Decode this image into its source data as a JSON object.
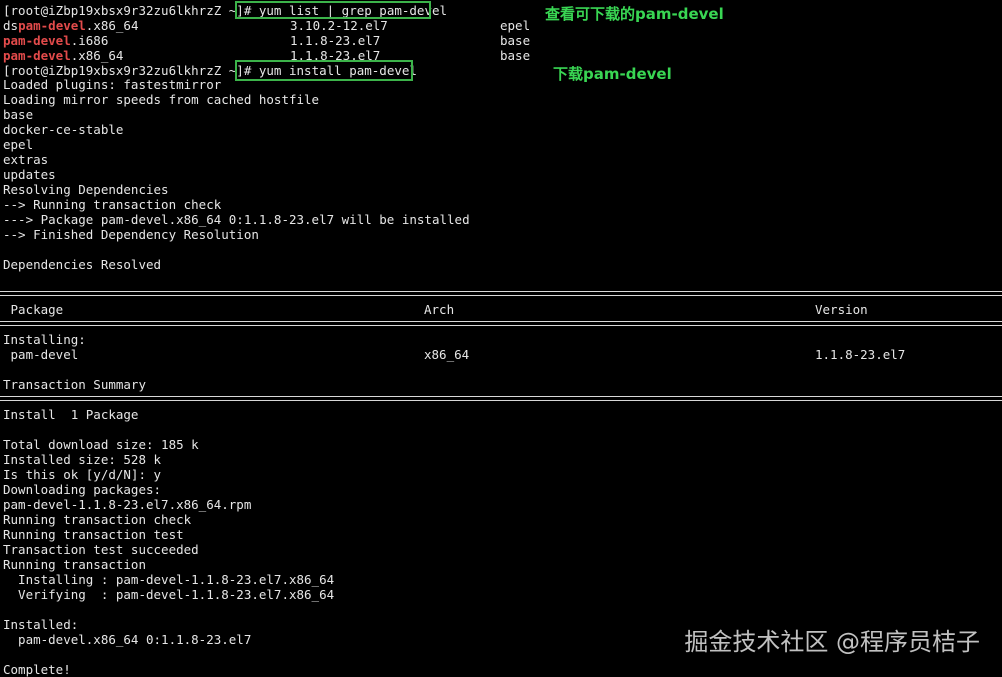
{
  "terminal": {
    "search": {
      "prompt": "[root@iZbp19xbsx9r32zu6lkhrzZ ~]#",
      "command": " yum list | grep pam-devel",
      "annotation": "查看可下载的pam-devel",
      "results": [
        {
          "prefix": "ds",
          "highlight": "pam-devel",
          "suffix": ".x86_64",
          "version": "3.10.2-12.el7",
          "repo": "epel"
        },
        {
          "prefix": "",
          "highlight": "pam-devel",
          "suffix": ".i686",
          "version": "1.1.8-23.el7",
          "repo": "base"
        },
        {
          "prefix": "",
          "highlight": "pam-devel",
          "suffix": ".x86_64",
          "version": "1.1.8-23.el7",
          "repo": "base"
        }
      ]
    },
    "install": {
      "prompt": "[root@iZbp19xbsx9r32zu6lkhrzZ ~]#",
      "command": " yum install pam-devel",
      "annotation": "下载pam-devel"
    },
    "output1": [
      "Loaded plugins: fastestmirror",
      "Loading mirror speeds from cached hostfile",
      "base",
      "docker-ce-stable",
      "epel",
      "extras",
      "updates",
      "Resolving Dependencies",
      "--> Running transaction check",
      "---> Package pam-devel.x86_64 0:1.1.8-23.el7 will be installed",
      "--> Finished Dependency Resolution",
      "",
      "Dependencies Resolved"
    ],
    "table": {
      "headers": [
        " Package",
        "Arch",
        "Version"
      ],
      "installing_label": "Installing:",
      "row": [
        " pam-devel",
        "x86_64",
        "1.1.8-23.el7"
      ]
    },
    "summary": {
      "title": "Transaction Summary",
      "install_line": "Install  1 Package"
    },
    "output2": [
      "Total download size: 185 k",
      "Installed size: 528 k",
      "Is this ok [y/d/N]: y",
      "Downloading packages:",
      "pam-devel-1.1.8-23.el7.x86_64.rpm",
      "Running transaction check",
      "Running transaction test",
      "Transaction test succeeded",
      "Running transaction",
      "  Installing : pam-devel-1.1.8-23.el7.x86_64",
      "  Verifying  : pam-devel-1.1.8-23.el7.x86_64",
      "",
      "Installed:",
      "  pam-devel.x86_64 0:1.1.8-23.el7",
      "",
      "Complete!"
    ],
    "watermark": "掘金技术社区 @程序员桔子",
    "colors": {
      "background": "#000000",
      "text": "#e6e6e6",
      "highlight": "#e34b4b",
      "annotation": "#39d653",
      "box": "#3cb34a"
    }
  }
}
